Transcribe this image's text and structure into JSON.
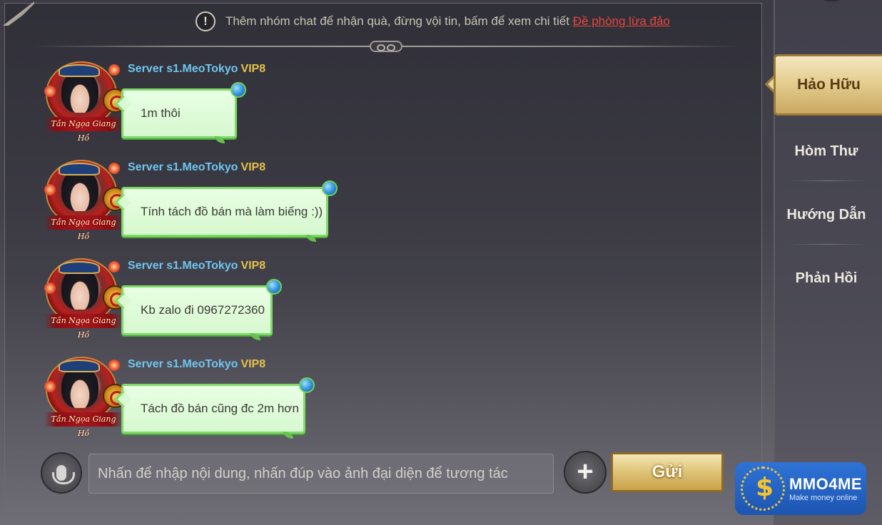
{
  "notice": {
    "icon": "exclamation-icon",
    "text": "Thêm nhóm chat để nhận quà, đừng vội tin, bấm để xem chi tiết",
    "link": "Đề phòng lừa đảo",
    "link_color": "#e8453b"
  },
  "messages": [
    {
      "sender": "Server s1.MeoTokyo",
      "vip": "VIP8",
      "text": "1m thôi",
      "avatar_caption": "Tần Ngọa Giang Hồ"
    },
    {
      "sender": "Server s1.MeoTokyo",
      "vip": "VIP8",
      "text": "Tính tách đồ bán mà làm biếng :))",
      "avatar_caption": "Tần Ngọa Giang Hồ"
    },
    {
      "sender": "Server s1.MeoTokyo",
      "vip": "VIP8",
      "text": "Kb zalo đi 0967272360",
      "avatar_caption": "Tần Ngọa Giang Hồ"
    },
    {
      "sender": "Server s1.MeoTokyo",
      "vip": "VIP8",
      "text": "Tách đồ bán cũng đc 2m hơn",
      "avatar_caption": "Tần Ngọa Giang Hồ"
    }
  ],
  "input": {
    "placeholder": "Nhấn để nhập nội dung, nhấn đúp vào ảnh đại diện để tương tác",
    "value": "",
    "mic_icon": "microphone-icon",
    "plus_icon": "plus-icon",
    "send_label": "Gửi"
  },
  "sidebar": {
    "tabs": [
      {
        "label": "Hảo Hữu",
        "active": true
      },
      {
        "label": "Hòm Thư",
        "active": false
      },
      {
        "label": "Hướng Dẫn",
        "active": false
      },
      {
        "label": "Phản Hồi",
        "active": false
      }
    ]
  },
  "watermark": {
    "brand": "MMO4ME",
    "slogan": "Make money online"
  },
  "colors": {
    "sender_name": "#6ec6f0",
    "vip": "#e4c24a",
    "bubble_bg": "#e8ffe3",
    "bubble_border": "#7fd86a",
    "send_button": "#e0c67b"
  }
}
